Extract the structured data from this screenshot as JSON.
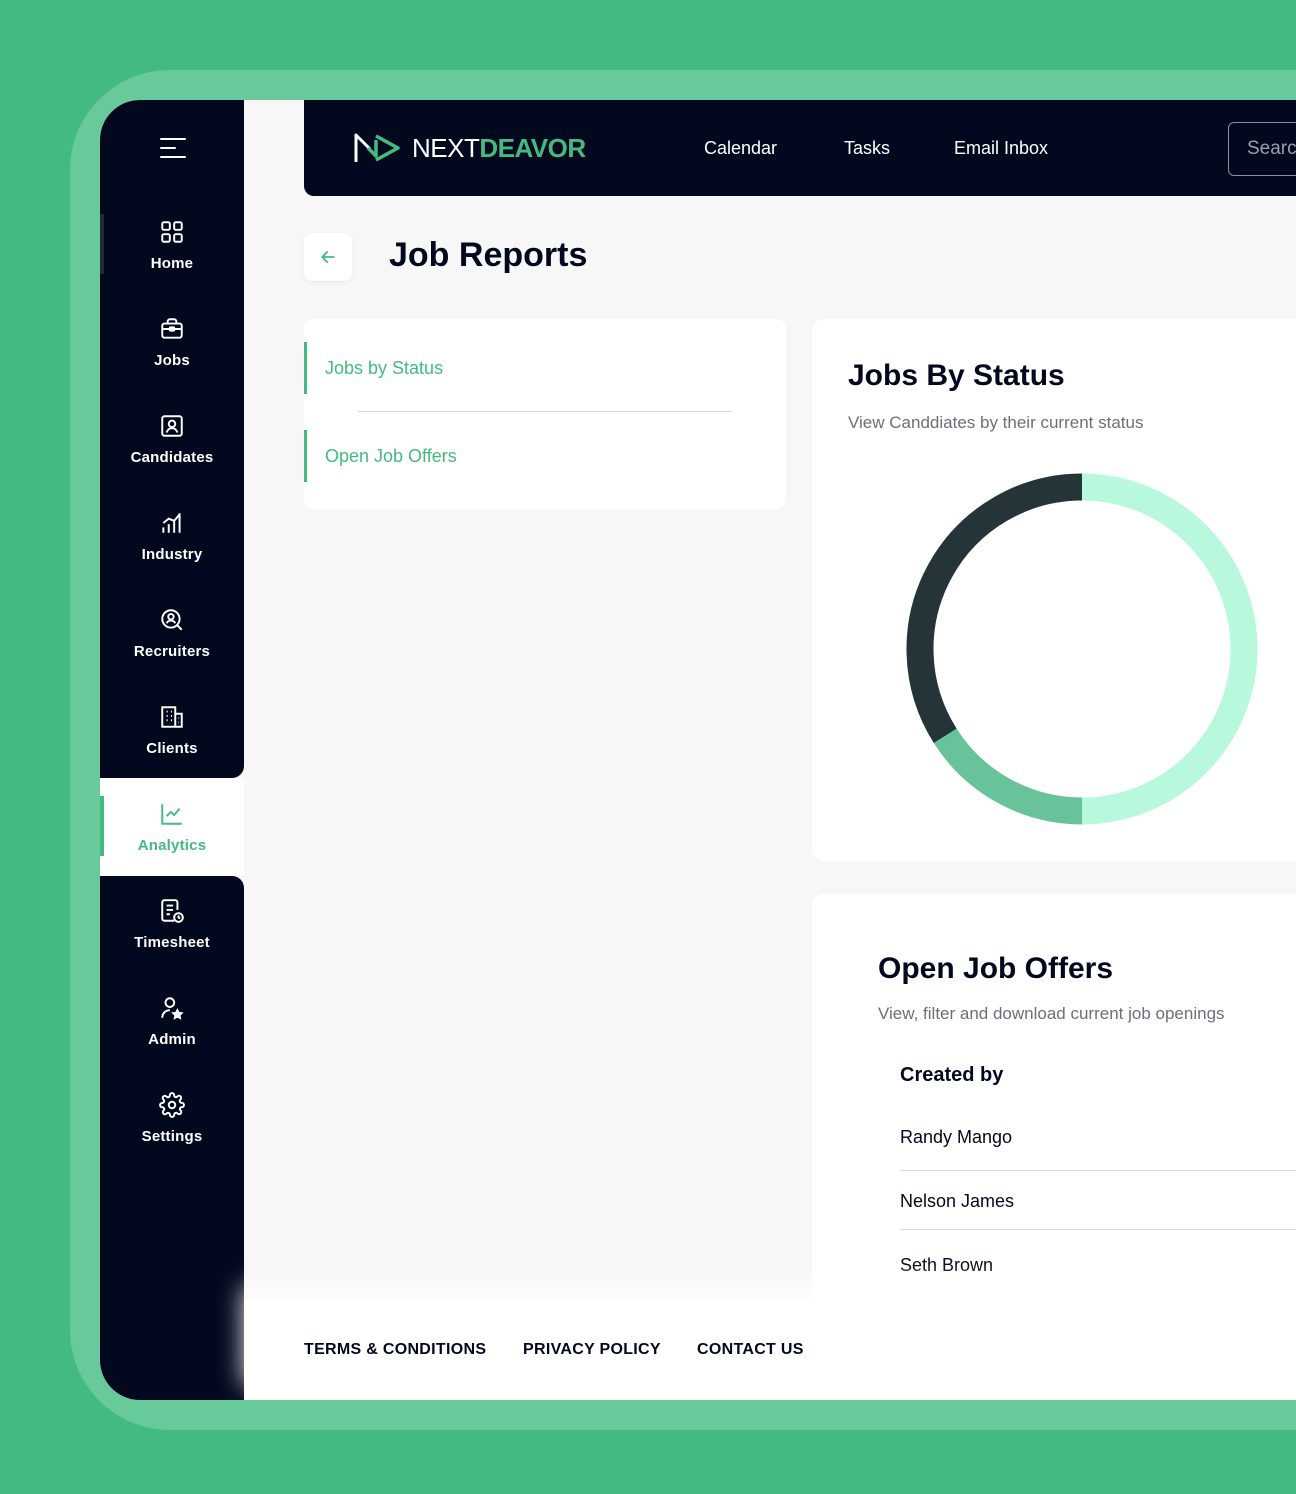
{
  "brand": {
    "logo_light": "NEXT",
    "logo_accent": "DEAVOR",
    "accent_color": "#43bb80",
    "dark_color": "#02081d"
  },
  "sidebar": {
    "items": [
      {
        "label": "Home",
        "icon": "grid-icon"
      },
      {
        "label": "Jobs",
        "icon": "briefcase-icon"
      },
      {
        "label": "Candidates",
        "icon": "id-card-icon"
      },
      {
        "label": "Industry",
        "icon": "bar-chart-icon"
      },
      {
        "label": "Recruiters",
        "icon": "search-user-icon"
      },
      {
        "label": "Clients",
        "icon": "building-icon"
      },
      {
        "label": "Analytics",
        "icon": "line-chart-icon",
        "active": true
      },
      {
        "label": "Timesheet",
        "icon": "timesheet-icon"
      },
      {
        "label": "Admin",
        "icon": "admin-user-icon"
      },
      {
        "label": "Settings",
        "icon": "gear-icon"
      }
    ]
  },
  "header": {
    "links": [
      "Calendar",
      "Tasks",
      "Email Inbox"
    ],
    "search_placeholder": "Search"
  },
  "page": {
    "title": "Job Reports"
  },
  "reports": [
    "Jobs by Status",
    "Open Job Offers"
  ],
  "status_card": {
    "title": "Jobs By Status",
    "subtitle": "View Canddiates by their current status"
  },
  "chart_data": {
    "type": "pie",
    "style": "donut",
    "values": [
      50,
      16,
      34
    ],
    "colors": [
      "#b8f9dd",
      "#68c39a",
      "#253438"
    ]
  },
  "offers_card": {
    "title": "Open Job Offers",
    "subtitle": "View, filter and download current job openings",
    "column": "Created by",
    "rows": [
      "Randy Mango",
      "Nelson James",
      "Seth Brown"
    ]
  },
  "footer": {
    "links": [
      "TERMS & CONDITIONS",
      "PRIVACY POLICY",
      "CONTACT US"
    ]
  }
}
